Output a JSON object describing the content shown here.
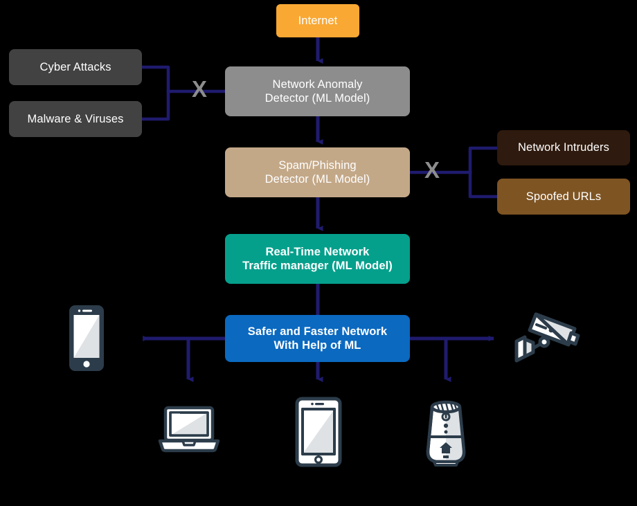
{
  "diagram": {
    "title": "Machine Learning Network Security Flow",
    "background_color": "#000000",
    "arrow_color": "#1f1b6e",
    "block_marker": "X",
    "block_marker_color": "#8d8d8d"
  },
  "nodes": {
    "internet": {
      "label": "Internet",
      "color": "#f9a833",
      "text_color": "#ffffff"
    },
    "cyber_attacks": {
      "label": "Cyber Attacks",
      "color": "#424242",
      "text_color": "#ffffff"
    },
    "malware_viruses": {
      "label": "Malware & Viruses",
      "color": "#424242",
      "text_color": "#ffffff"
    },
    "network_anomaly_detector": {
      "label": "Network Anomaly\nDetector (ML Model)",
      "color": "#8d8d8d",
      "text_color": "#ffffff"
    },
    "spam_phishing_detector": {
      "label": "Spam/Phishing\nDetector (ML Model)",
      "color": "#c3a888",
      "text_color": "#ffffff"
    },
    "network_intruders": {
      "label": "Network Intruders",
      "color": "#2e1a0e",
      "text_color": "#ffffff"
    },
    "spoofed_urls": {
      "label": "Spoofed URLs",
      "color": "#7e5423",
      "text_color": "#ffffff"
    },
    "realtime_traffic_manager": {
      "label": "Real-Time Network\nTraffic manager (ML Model)",
      "color": "#05a08c",
      "text_color": "#ffffff"
    },
    "safer_faster_network": {
      "label": "Safer and Faster Network\nWith Help of ML",
      "color": "#0b69c0",
      "text_color": "#ffffff"
    }
  },
  "blockers": [
    {
      "name": "left-block-x",
      "label": "X"
    },
    {
      "name": "right-block-x",
      "label": "X"
    }
  ],
  "devices": [
    {
      "name": "smartphone-icon",
      "label": "Smartphone"
    },
    {
      "name": "security-camera-icon",
      "label": "Security Camera"
    },
    {
      "name": "laptop-icon",
      "label": "Laptop"
    },
    {
      "name": "tablet-icon",
      "label": "Tablet"
    },
    {
      "name": "smart-speaker-icon",
      "label": "Smart Speaker"
    }
  ],
  "icon_colors": {
    "outline": "#2b3a४7",
    "stroke": "#2c3c4a",
    "fill_light": "#ffffff",
    "fill_shade": "#dfe2e5"
  }
}
